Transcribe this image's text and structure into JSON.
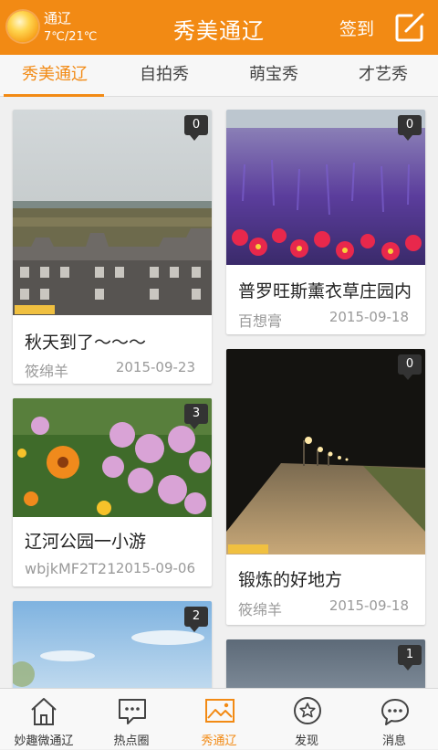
{
  "header": {
    "city": "通辽",
    "temperature": "7℃/21℃",
    "title": "秀美通辽",
    "checkin_label": "签到",
    "weather_icon": "sun-icon",
    "compose_icon": "edit-icon",
    "accent_color": "#f28a14"
  },
  "tabs": [
    {
      "label": "秀美通辽",
      "active": true
    },
    {
      "label": "自拍秀",
      "active": false
    },
    {
      "label": "萌宝秀",
      "active": false
    },
    {
      "label": "才艺秀",
      "active": false
    }
  ],
  "posts": [
    {
      "count": "0",
      "title": "秋天到了～～～",
      "author": "筱绵羊",
      "date": "2015-09-23"
    },
    {
      "count": "0",
      "title": "普罗旺斯薰衣草庄园内",
      "author": "百想膏",
      "date": "2015-09-18"
    },
    {
      "count": "3",
      "title": "辽河公园一小游",
      "author": "wbjkMF2T21",
      "date": "2015-09-06"
    },
    {
      "count": "0",
      "title": "锻炼的好地方",
      "author": "筱绵羊",
      "date": "2015-09-18"
    },
    {
      "count": "2"
    },
    {
      "count": "1"
    }
  ],
  "bottom_nav": [
    {
      "label": "妙趣微通辽",
      "icon": "home-icon",
      "active": false
    },
    {
      "label": "热点圈",
      "icon": "chat-bubble-icon",
      "active": false
    },
    {
      "label": "秀通辽",
      "icon": "image-icon",
      "active": true
    },
    {
      "label": "发现",
      "icon": "star-circle-icon",
      "active": false
    },
    {
      "label": "消息",
      "icon": "message-icon",
      "active": false
    }
  ]
}
